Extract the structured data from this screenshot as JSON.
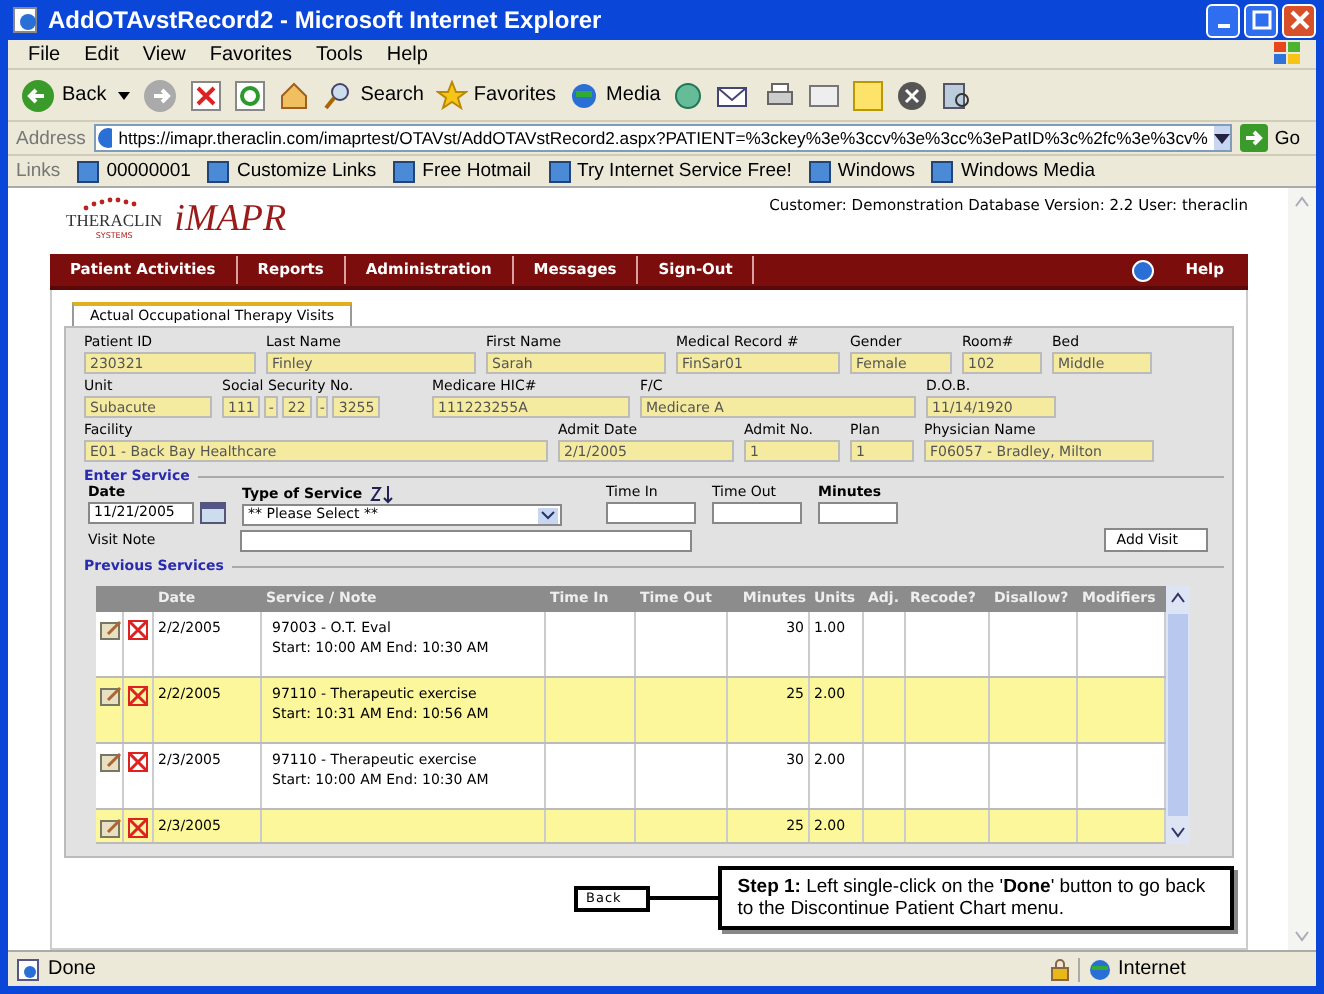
{
  "window": {
    "title": "AddOTAvstRecord2 - Microsoft Internet Explorer"
  },
  "menu": [
    {
      "label": "File"
    },
    {
      "label": "Edit"
    },
    {
      "label": "View"
    },
    {
      "label": "Favorites"
    },
    {
      "label": "Tools"
    },
    {
      "label": "Help"
    }
  ],
  "toolbar": {
    "back": "Back",
    "search": "Search",
    "favorites": "Favorites",
    "media": "Media"
  },
  "address": {
    "label": "Address",
    "url": "https://imapr.theraclin.com/imaprtest/OTAVst/AddOTAVstRecord2.aspx?PATIENT=%3ckey%3e%3ccv%3e%3cc%3ePatID%3c%2fc%3e%3cv%",
    "go": "Go"
  },
  "links": {
    "label": "Links",
    "items": [
      "00000001",
      "Customize Links",
      "Free Hotmail",
      "Try Internet Service Free!",
      "Windows",
      "Windows Media"
    ]
  },
  "logo": {
    "brand": "THERACLIN",
    "tagline": "SYSTEMS",
    "product": "iMAPR"
  },
  "customer_info": "Customer: Demonstration Database Version: 2.2 User: theraclin",
  "nav": {
    "items": [
      "Patient Activities",
      "Reports",
      "Administration",
      "Messages",
      "Sign-Out"
    ],
    "help": "Help"
  },
  "tab": {
    "label": "Actual Occupational Therapy Visits",
    "selected": true
  },
  "patient_fields": [
    [
      {
        "label": "Patient ID",
        "value": "230321"
      },
      {
        "label": "Last Name",
        "value": "Finley"
      },
      {
        "label": "First Name",
        "value": "Sarah"
      },
      {
        "label": "Medical Record #",
        "value": "FinSar01"
      },
      {
        "label": "Gender",
        "value": "Female"
      },
      {
        "label": "Room#",
        "value": "102"
      },
      {
        "label": "Bed",
        "value": "Middle"
      }
    ],
    [
      {
        "label": "Unit",
        "value": "Subacute"
      },
      {
        "label": "Social Security No.",
        "parts": [
          "111",
          "-",
          "22",
          "-",
          "3255"
        ]
      },
      {
        "label": "Medicare HIC#",
        "value": "111223255A"
      },
      {
        "label": "F/C",
        "value": "Medicare A"
      },
      {
        "label": "D.O.B.",
        "value": "11/14/1920"
      }
    ],
    [
      {
        "label": "Facility",
        "value": "E01 - Back Bay Healthcare"
      },
      {
        "label": "Admit Date",
        "value": "2/1/2005"
      },
      {
        "label": "Admit No.",
        "value": "1"
      },
      {
        "label": "Plan",
        "value": "1"
      },
      {
        "label": "Physician Name",
        "value": "F06057 - Bradley, Milton"
      }
    ]
  ],
  "enter_service": {
    "title": "Enter Service",
    "date_label": "Date",
    "date_value": "11/21/2005",
    "type_label": "Type of Service",
    "type_value": "** Please Select **",
    "time_in_label": "Time In",
    "time_out_label": "Time Out",
    "minutes_label": "Minutes",
    "visit_note_label": "Visit Note",
    "add_button": "Add Visit"
  },
  "previous_services": {
    "title": "Previous Services",
    "columns": [
      "Date",
      "Service / Note",
      "Time In",
      "Time Out",
      "Minutes",
      "Units",
      "Adj.",
      "Recode?",
      "Disallow?",
      "Modifiers"
    ],
    "rows": [
      {
        "date": "2/2/2005",
        "service": "97003 - O.T. Eval",
        "note": "Start: 10:00 AM End: 10:30 AM",
        "minutes": "30",
        "units": "1.00",
        "highlighted": false
      },
      {
        "date": "2/2/2005",
        "service": "97110 - Therapeutic exercise",
        "note": "Start: 10:31 AM End: 10:56 AM",
        "minutes": "25",
        "units": "2.00",
        "highlighted": true
      },
      {
        "date": "2/3/2005",
        "service": "97110 - Therapeutic exercise",
        "note": "Start: 10:00 AM End: 10:30 AM",
        "minutes": "30",
        "units": "2.00",
        "highlighted": false
      },
      {
        "date": "2/3/2005",
        "minutes": "25",
        "units": "2.00",
        "highlighted": true
      }
    ]
  },
  "back_button": "Back",
  "callout": "**Step 1:** Left single-click on the '**Done**' button to go back to the Discontinue Patient Chart menu.",
  "status_bar": {
    "text": "Done",
    "zone": "Internet"
  }
}
